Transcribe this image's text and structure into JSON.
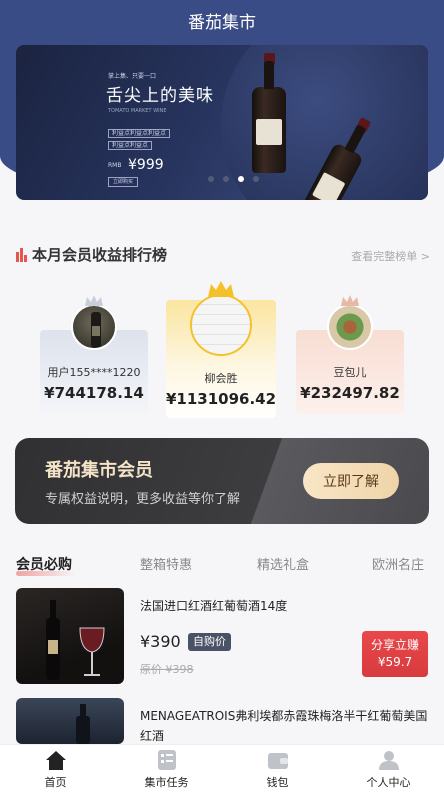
{
  "app": {
    "title": "番茄集市"
  },
  "banner": {
    "small_text": "掌上集、只要一口",
    "title": "舌尖上的美味",
    "subtitle": "TOMATO MARKET WINE",
    "tags": [
      "利益点利益点利益点",
      "利益点利益点"
    ],
    "currency": "RMB",
    "price": "¥999",
    "buy_label": "立即购买",
    "active_dot": 2,
    "dot_count": 4
  },
  "ranking": {
    "title": "本月会员收益排行榜",
    "more": "查看完整榜单 >",
    "entries": [
      {
        "rank": 2,
        "name": "用户155****1220",
        "amount": "¥744178.14"
      },
      {
        "rank": 1,
        "name": "柳会胜",
        "amount": "¥1131096.42"
      },
      {
        "rank": 3,
        "name": "豆包儿",
        "amount": "¥232497.82"
      }
    ]
  },
  "membership": {
    "title": "番茄集市会员",
    "desc": "专属权益说明，更多收益等你了解",
    "button": "立即了解"
  },
  "tabs": [
    "会员必购",
    "整箱特惠",
    "精选礼盒",
    "欧洲名庄"
  ],
  "products": [
    {
      "name": "法国进口红酒红葡萄酒14度",
      "price": "¥390",
      "self_buy": "自购价",
      "original": "原价 ¥398",
      "share_label": "分享立赚",
      "share_amount": "¥59.7"
    },
    {
      "name": "MENAGEATROIS弗利埃都赤霞珠梅洛半干红葡萄美国红酒"
    }
  ],
  "tabbar": [
    {
      "label": "首页",
      "icon": "home-icon",
      "active": true
    },
    {
      "label": "集市任务",
      "icon": "task-list-icon"
    },
    {
      "label": "钱包",
      "icon": "wallet-icon"
    },
    {
      "label": "个人中心",
      "icon": "user-icon"
    }
  ],
  "colors": {
    "header": "#3a4c86",
    "accent_red": "#e0584e",
    "gold": "#f0d4a8"
  }
}
